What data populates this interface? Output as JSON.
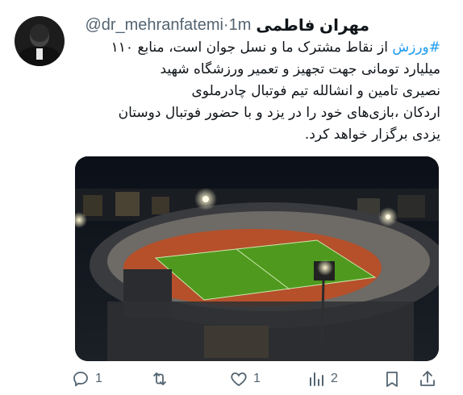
{
  "author": {
    "name": "مهران فاطمی",
    "handle": "@dr_mehranfatemi",
    "time": "1m",
    "separator": "·"
  },
  "tweet": {
    "lines": [
      {
        "hashtag": "#ورزش",
        "text": " از نقاط مشترک ما و نسل جوان است، منابع ۱۱۰"
      },
      {
        "text": "میلیارد تومانی جهت تجهیز و تعمیر ورزشگاه شهید"
      },
      {
        "text": "نصیری تامین و انشالله تیم فوتبال چادرملوی"
      },
      {
        "text": "اردکان ،بازی‌های خود را در یزد و با حضور فوتبال دوستان"
      },
      {
        "text": "یزدی برگزار خواهد کرد."
      }
    ]
  },
  "media": {
    "icon": "stadium-photo"
  },
  "actions": {
    "reply": {
      "icon": "reply-icon",
      "count": "1"
    },
    "retweet": {
      "icon": "retweet-icon",
      "count": ""
    },
    "like": {
      "icon": "heart-icon",
      "count": "1"
    },
    "views": {
      "icon": "views-icon",
      "count": "2"
    },
    "bookmark": {
      "icon": "bookmark-icon"
    },
    "share": {
      "icon": "share-icon"
    }
  },
  "colors": {
    "hashtag": "#1d9bf0",
    "secondary": "#536471",
    "text": "#0f1419"
  }
}
